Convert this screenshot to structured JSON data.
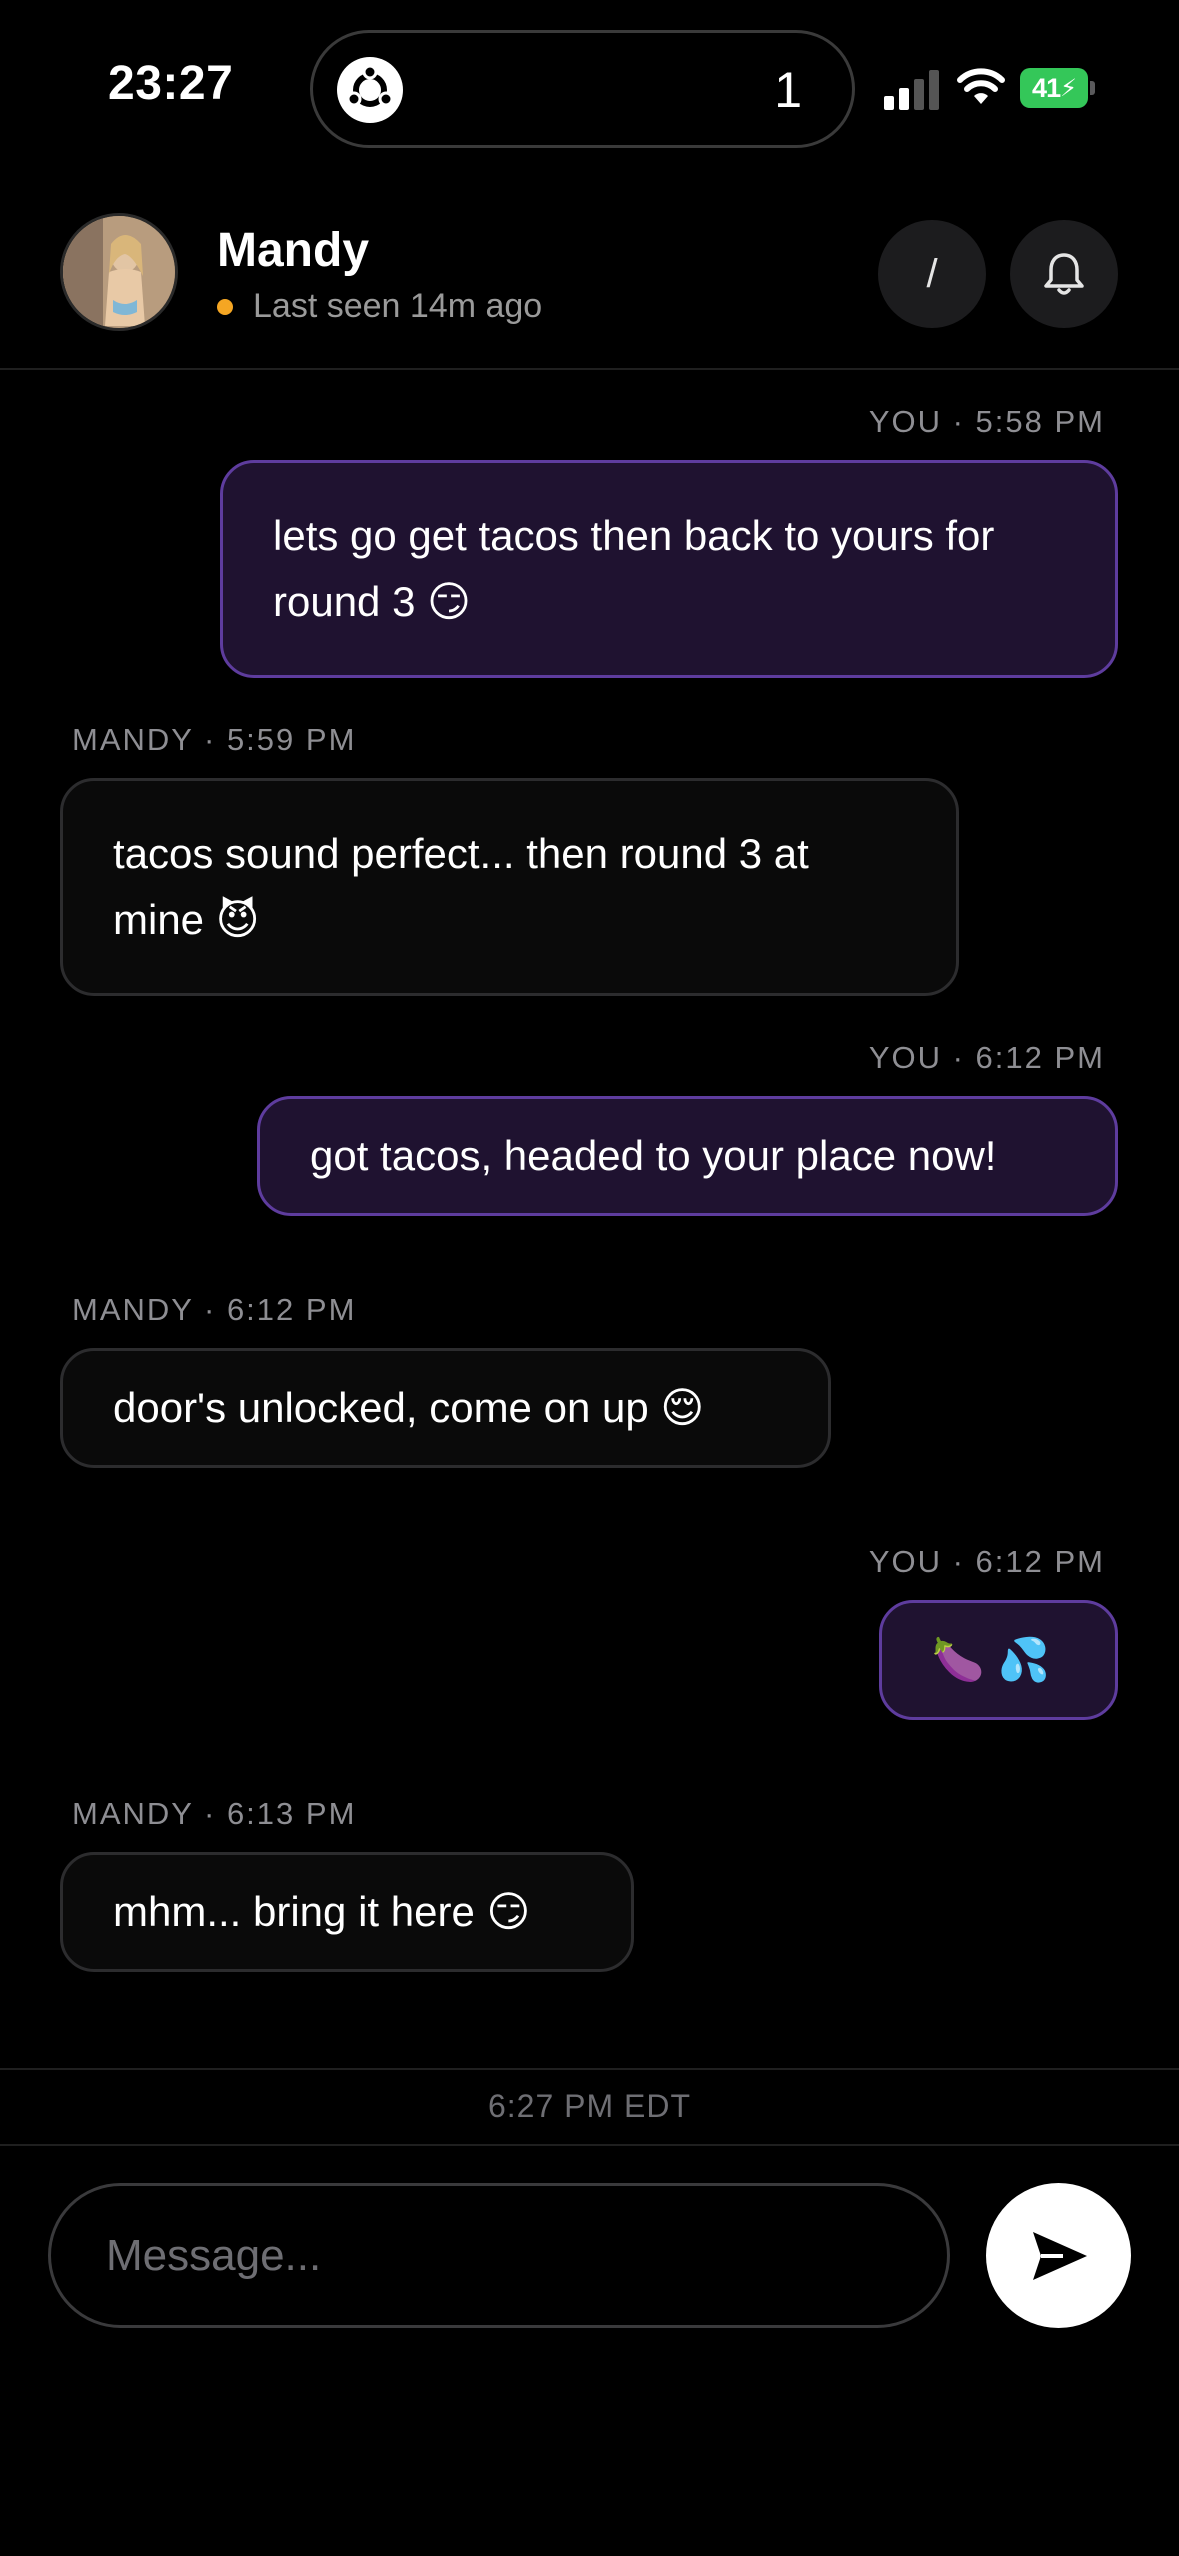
{
  "status_bar": {
    "time": "23:27",
    "island_count": "1",
    "battery": "41"
  },
  "header": {
    "name": "Mandy",
    "last_seen": "Last seen 14m ago",
    "slash_button_label": "/",
    "status_color": "#f5a623"
  },
  "messages": [
    {
      "direction": "out",
      "meta": "YOU · 5:58 PM",
      "text": "lets go get tacos then back to yours for round 3 😏"
    },
    {
      "direction": "in",
      "meta": "MANDY · 5:59 PM",
      "text": "tacos sound perfect... then round 3 at mine 😈"
    },
    {
      "direction": "out",
      "meta": "YOU · 6:12 PM",
      "text": "got tacos, headed to your place now!"
    },
    {
      "direction": "in",
      "meta": "MANDY · 6:12 PM",
      "text": "door's unlocked, come on up 😌"
    },
    {
      "direction": "out",
      "meta": "YOU · 6:12 PM",
      "text": "🍆 💦"
    },
    {
      "direction": "in",
      "meta": "MANDY · 6:13 PM",
      "text": "mhm... bring it here 😏"
    }
  ],
  "footer": {
    "timezone_label": "6:27 PM EDT",
    "message_placeholder": "Message..."
  },
  "colors": {
    "outgoing_bubble": "#1f1230",
    "outgoing_border": "#5e3c9e",
    "incoming_border": "#2c2c2e"
  }
}
